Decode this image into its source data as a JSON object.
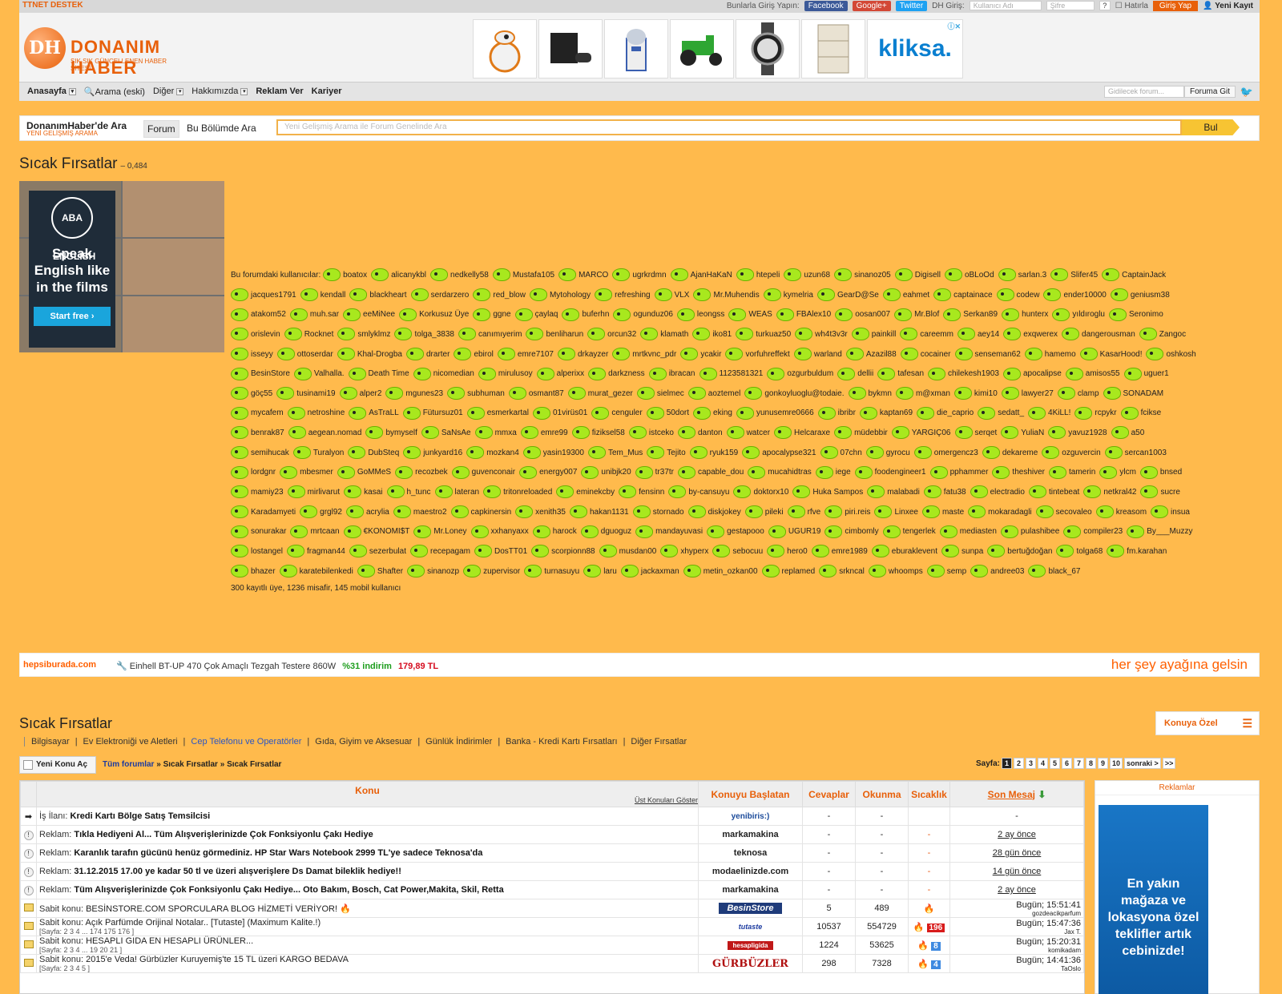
{
  "topbar": {
    "brand": "TTNET DESTEK",
    "login_prompt": "Bunlarla Giriş Yapın:",
    "facebook": "Facebook",
    "google": "Google+",
    "twitter": "Twitter",
    "dh_login": "DH Giriş:",
    "username_placeholder": "Kullanıcı Adı",
    "password_placeholder": "Şifre",
    "help": "?",
    "remember": "Hatırla",
    "login_button": "Giriş Yap",
    "register": "Yeni Kayıt"
  },
  "logo": {
    "name": "DONANIM HABER",
    "tagline": "SIK SIK GÜNCELLENEN HABER SİTESİ",
    "mark": "DH"
  },
  "ads_banner": {
    "brand": "kliksa.",
    "items": [
      "bb8-toy",
      "console",
      "robot-toy",
      "tractor-toy",
      "watch",
      "cabinet"
    ]
  },
  "nav": {
    "items": [
      {
        "label": "Anasayfa",
        "dropdown": true
      },
      {
        "label": "Arama (eski)",
        "dropdown": false
      },
      {
        "label": "Diğer",
        "dropdown": true
      },
      {
        "label": "Hakkımızda",
        "dropdown": true
      },
      {
        "label": "Reklam Ver",
        "dropdown": false
      },
      {
        "label": "Kariyer",
        "dropdown": false
      }
    ],
    "goto_placeholder": "Gidilecek forum...",
    "goto_button": "Foruma Git"
  },
  "search": {
    "title": "DonanımHaber'de Ara",
    "subtitle": "YENİ GELİŞMİŞ ARAMA",
    "tab_forum": "Forum",
    "tab_section": "Bu Bölümde Ara",
    "placeholder": "Yeni Gelişmiş Arama ile Forum Genelinde Ara",
    "button": "Bul"
  },
  "section1": {
    "title": "Sıcak Fırsatlar",
    "rating": "– 0,484"
  },
  "aba_ad": {
    "seal": "ABA ENGLISH",
    "headline": "Speak English like in the films",
    "cta": "Start free"
  },
  "users": {
    "label": "Bu forumdaki kullanıcılar:",
    "list": [
      "boatox",
      "alicanykbl",
      "nedkelly58",
      "Mustafa105",
      "MARCO",
      "ugrkrdmn",
      "AjanHaKaN",
      "htepeli",
      "uzun68",
      "sinanoz05",
      "Digisell",
      "oBLoOd",
      "sarlan.3",
      "Slifer45",
      "CaptainJack",
      "jacques1791",
      "kendall",
      "blackheart",
      "serdarzero",
      "red_blow",
      "Mytohology",
      "refreshing",
      "VLX",
      "Mr.Muhendis",
      "kymelria",
      "GearD@Se",
      "eahmet",
      "captainace",
      "codew",
      "ender10000",
      "geniusm38",
      "atakom52",
      "muh.sar",
      "eeMiNee",
      "Korkusuz Üye",
      "ggne",
      "çaylaq",
      "buferhn",
      "ogunduz06",
      "leongss",
      "WEAS",
      "FBAlex10",
      "oosan007",
      "Mr.Blof",
      "Serkan89",
      "hunterx",
      "yıldıroglu",
      "Seronimo",
      "orislevin",
      "Rocknet",
      "smlyklmz",
      "tolga_3838",
      "canımıyerim",
      "benliharun",
      "orcun32",
      "klamath",
      "iko81",
      "turkuaz50",
      "wh4t3v3r",
      "painkill",
      "careemm",
      "aey14",
      "exqwerex",
      "dangerousman",
      "Zangoc",
      "isseyy",
      "ottoserdar",
      "Khal-Drogba",
      "drarter",
      "ebirol",
      "emre7107",
      "drkayzer",
      "mrtkvnc_pdr",
      "ycakir",
      "vorfuhreffekt",
      "warland",
      "Azazil88",
      "cocainer",
      "senseman62",
      "hamemo",
      "KasarHood!",
      "oshkosh",
      "BesinStore",
      "Valhalla.",
      "Death Time",
      "nicomedian",
      "mirulusoy",
      "alperixx",
      "darkzness",
      "ibracan",
      "1123581321",
      "ozgurbuldum",
      "dellii",
      "tafesan",
      "chilekesh1903",
      "apocalipse",
      "amisos55",
      "uguer1",
      "göç55",
      "tusinami19",
      "alper2",
      "mgunes23",
      "subhuman",
      "osmant87",
      "murat_gezer",
      "sielmec",
      "aoztemel",
      "gonkoyluoglu@todaie.",
      "bykmn",
      "m@xman",
      "kimi10",
      "lawyer27",
      "clamp",
      "SONADAM",
      "mycafem",
      "netroshine",
      "AsTraLL",
      "Fütursuz01",
      "esmerkartal",
      "01virüs01",
      "cenguler",
      "50dort",
      "eking",
      "yunusemre0666",
      "ibribr",
      "kaptan69",
      "die_caprio",
      "sedatt_",
      "4KiLL!",
      "rcpykr",
      "fcikse",
      "benrak87",
      "aegean.nomad",
      "bymyself",
      "SaNsAe",
      "mmxa",
      "emre99",
      "fiziksel58",
      "istceko",
      "danton",
      "watcer",
      "Helcaraxe",
      "müdebbir",
      "YARGIÇ06",
      "serqet",
      "YuliaN",
      "yavuz1928",
      "a50",
      "semihucak",
      "Turalyon",
      "DubSteq",
      "junkyard16",
      "mozkan4",
      "yasin19300",
      "Tem_Mus",
      "Tejito",
      "ryuk159",
      "apocalypse321",
      "07chn",
      "gyrocu",
      "omergencz3",
      "dekareme",
      "ozguvercin",
      "sercan1003",
      "lordgnr",
      "mbesmer",
      "GoMMeS",
      "recozbek",
      "guvenconair",
      "energy007",
      "unibjk20",
      "tr37tr",
      "capable_dou",
      "mucahidtras",
      "iege",
      "foodengineer1",
      "pphammer",
      "theshiver",
      "tamerin",
      "ylcm",
      "bnsed",
      "mamiy23",
      "mirlivarut",
      "kasai",
      "h_tunc",
      "lateran",
      "tritonreloaded",
      "eminekcby",
      "fensinn",
      "by-cansuyu",
      "doktorx10",
      "Huka Sampos",
      "malabadi",
      "fatu38",
      "electradio",
      "tintebeat",
      "netkral42",
      "sucre",
      "Karadamyeti",
      "grgl92",
      "acrylia",
      "maestro2",
      "capkinersin",
      "xenith35",
      "hakan1131",
      "stornado",
      "diskjokey",
      "pileki",
      "rfve",
      "piri.reis",
      "Linxee",
      "maste",
      "mokaradagli",
      "secovaleo",
      "kreasom",
      "insua",
      "sonurakar",
      "mrtcaan",
      "€KONOMI$T",
      "Mr.Loney",
      "xxhanyaxx",
      "harock",
      "dguoguz",
      "mandayuvasi",
      "gestapooo",
      "UGUR19",
      "cimbomly",
      "tengerlek",
      "mediasten",
      "pulashibee",
      "compiler23",
      "By___Muzzy",
      "lostangel",
      "fragman44",
      "sezerbulat",
      "recepagam",
      "DosTT01",
      "scorpionn88",
      "musdan00",
      "xhyperx",
      "sebocuu",
      "hero0",
      "emre1989",
      "eburaklevent",
      "sunpa",
      "bertuğdoğan",
      "tolga68",
      "fm.karahan",
      "bhazer",
      "karatebilenkedi",
      "Shafter",
      "sinanozp",
      "zupervisor",
      "turnasuyu",
      "laru",
      "jackaxman",
      "metin_ozkan00",
      "replamed",
      "srkncal",
      "whoomps",
      "semp",
      "andree03",
      "black_67"
    ],
    "total": "300 kayıtlı üye, 1236 misafir, 145 mobil kullanıcı"
  },
  "hepsiburada": {
    "logo": "hepsiburada.com",
    "product": "Einhell BT-UP 470 Çok Amaçlı Tezgah Testere 860W",
    "discount": "%31 indirim",
    "price": "179,89 TL",
    "slogan": "her şey ayağına gelsin"
  },
  "section2": {
    "title": "Sıcak Fırsatlar",
    "konuya_ozel": "Konuya Özel",
    "categories": [
      "Bilgisayar",
      "Ev Elektroniği ve Aletleri",
      "Cep Telefonu ve Operatörler",
      "Gıda, Giyim ve Aksesuar",
      "Günlük İndirimler",
      "Banka - Kredi Kartı Fırsatları",
      "Diğer Fırsatlar"
    ],
    "new_topic": "Yeni Konu Aç",
    "crumb_link": "Tüm forumlar",
    "crumb_rest": " » Sıcak Fırsatlar » Sıcak Fırsatlar",
    "pager_label": "Sayfa:",
    "pages": [
      "1",
      "2",
      "3",
      "4",
      "5",
      "6",
      "7",
      "8",
      "9",
      "10",
      "sonraki >",
      ">>"
    ]
  },
  "table": {
    "headers": {
      "topic": "Konu",
      "show_top": "Üst Konuları Göster",
      "starter": "Konuyu Başlatan",
      "replies": "Cevaplar",
      "views": "Okunma",
      "heat": "Sıcaklık",
      "last": "Son Mesaj"
    },
    "rows": [
      {
        "icon": "arrow",
        "prefix": "İş İlanı: ",
        "title": "Kredi Kartı Bölge Satış Temsilcisi",
        "bold": true,
        "pages": "",
        "starter": "yenibiris:)",
        "replies": "-",
        "views": "-",
        "heat": "",
        "badge": "",
        "last": "-",
        "last_user": ""
      },
      {
        "icon": "info",
        "prefix": "Reklam: ",
        "title": "Tıkla Hediyeni Al... Tüm Alışverişlerinizde Çok Fonksiyonlu Çakı Hediye",
        "bold": true,
        "pages": "",
        "starter": "markamakina",
        "replies": "-",
        "views": "-",
        "heat": "-",
        "badge": "",
        "last": "2 ay önce",
        "last_user": ""
      },
      {
        "icon": "info",
        "prefix": "Reklam: ",
        "title": "Karanlık tarafın gücünü henüz görmediniz. HP Star Wars Notebook 2999 TL'ye sadece Teknosa'da",
        "bold": true,
        "pages": "",
        "starter": "teknosa",
        "replies": "-",
        "views": "-",
        "heat": "-",
        "badge": "",
        "last": "28 gün önce",
        "last_user": ""
      },
      {
        "icon": "info",
        "prefix": "Reklam: ",
        "title": "31.12.2015 17.00 ye kadar 50 tl ve üzeri alışverişlere Ds Damat bileklik hediye!!",
        "bold": true,
        "pages": "",
        "starter": "modaelinizde.com",
        "replies": "-",
        "views": "-",
        "heat": "-",
        "badge": "",
        "last": "14 gün önce",
        "last_user": ""
      },
      {
        "icon": "info",
        "prefix": "Reklam: ",
        "title": "Tüm Alışverişlerinizde Çok Fonksiyonlu Çakı Hediye... Oto Bakım, Bosch, Cat Power,Makita, Skil, Retta",
        "bold": true,
        "pages": "",
        "starter": "markamakina",
        "replies": "-",
        "views": "-",
        "heat": "-",
        "badge": "",
        "last": "2 ay önce",
        "last_user": ""
      },
      {
        "icon": "folder",
        "prefix": "Sabit konu: ",
        "title": "BESİNSTORE.COM SPORCULARA BLOG HİZMETİ VERİYOR!",
        "bold": false,
        "pages": "",
        "starter": "BesinStore",
        "replies": "5",
        "views": "489",
        "heat": "🔥",
        "badge": "",
        "last": "Bugün; 15:51:41",
        "last_user": "gozdeacikparfum"
      },
      {
        "icon": "folder",
        "prefix": "Sabit konu: ",
        "title": "Açık Parfümde Orijinal Notalar.. [Tutaste] (Maximum Kalite.!)",
        "bold": false,
        "pages": "[Sayfa: 2 3 4 ... 174 175 176 ]",
        "starter": "tutaste",
        "replies": "10537",
        "views": "554729",
        "heat": "🔥",
        "badge": "196",
        "badge_color": "#d81b1b",
        "last": "Bugün; 15:47:36",
        "last_user": "Jax T."
      },
      {
        "icon": "folder",
        "prefix": "Sabit konu: ",
        "title": "HESAPLI GIDA EN HESAPLI ÜRÜNLER...",
        "bold": false,
        "pages": "[Sayfa: 2 3 4 ... 19 20 21 ]",
        "starter": "hesapligida",
        "replies": "1224",
        "views": "53625",
        "heat": "🔥",
        "badge": "8",
        "badge_color": "#3f8ae0",
        "last": "Bugün; 15:20:31",
        "last_user": "komikadam"
      },
      {
        "icon": "folder",
        "prefix": "Sabit konu: ",
        "title": "2015'e Veda! Gürbüzler Kuruyemiş'te 15 TL üzeri KARGO BEDAVA",
        "bold": false,
        "pages": "[Sayfa: 2 3 4 5 ]",
        "starter": "GÜRBÜZLER",
        "replies": "298",
        "views": "7328",
        "heat": "🔥",
        "badge": "4",
        "badge_color": "#3f8ae0",
        "last": "Bugün; 14:41:36",
        "last_user": "TaOslo"
      }
    ]
  },
  "right_ad": {
    "header": "Reklamlar",
    "text": "En yakın mağaza ve lokasyona özel teklifler artık cebinizde!"
  }
}
